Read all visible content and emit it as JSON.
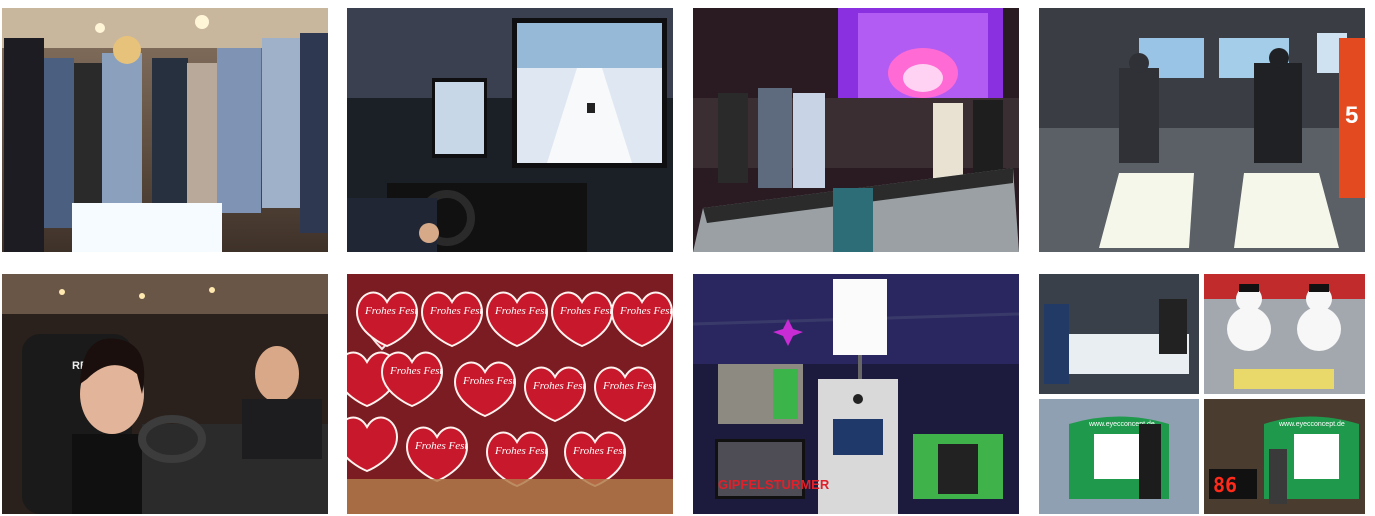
{
  "gallery": {
    "tiles": [
      {
        "subject": "ski-simulator-crowd"
      },
      {
        "subject": "racing-simulator-snow-game"
      },
      {
        "subject": "slot-car-racing-event"
      },
      {
        "subject": "ski-simulator-platforms",
        "sign_number": "5"
      },
      {
        "subject": "racing-seat-woman-laughing",
        "seat_brand": "REC"
      },
      {
        "subject": "gingerbread-hearts",
        "heart_text": "Frohes Fest"
      },
      {
        "subject": "photo-booth-event",
        "photo_caption": "GIPFELSTURMER"
      },
      {
        "subject": "snowmen-and-goal-games",
        "banner_text": "www.eyecconcept.de",
        "score": "86"
      }
    ]
  },
  "colors": {
    "background": "#ffffff",
    "heart_red": "#c8192c",
    "stage_purple": "#7a2bd6",
    "goal_green": "#1f9a4c",
    "scoreboard_red": "#ff2a1a"
  }
}
